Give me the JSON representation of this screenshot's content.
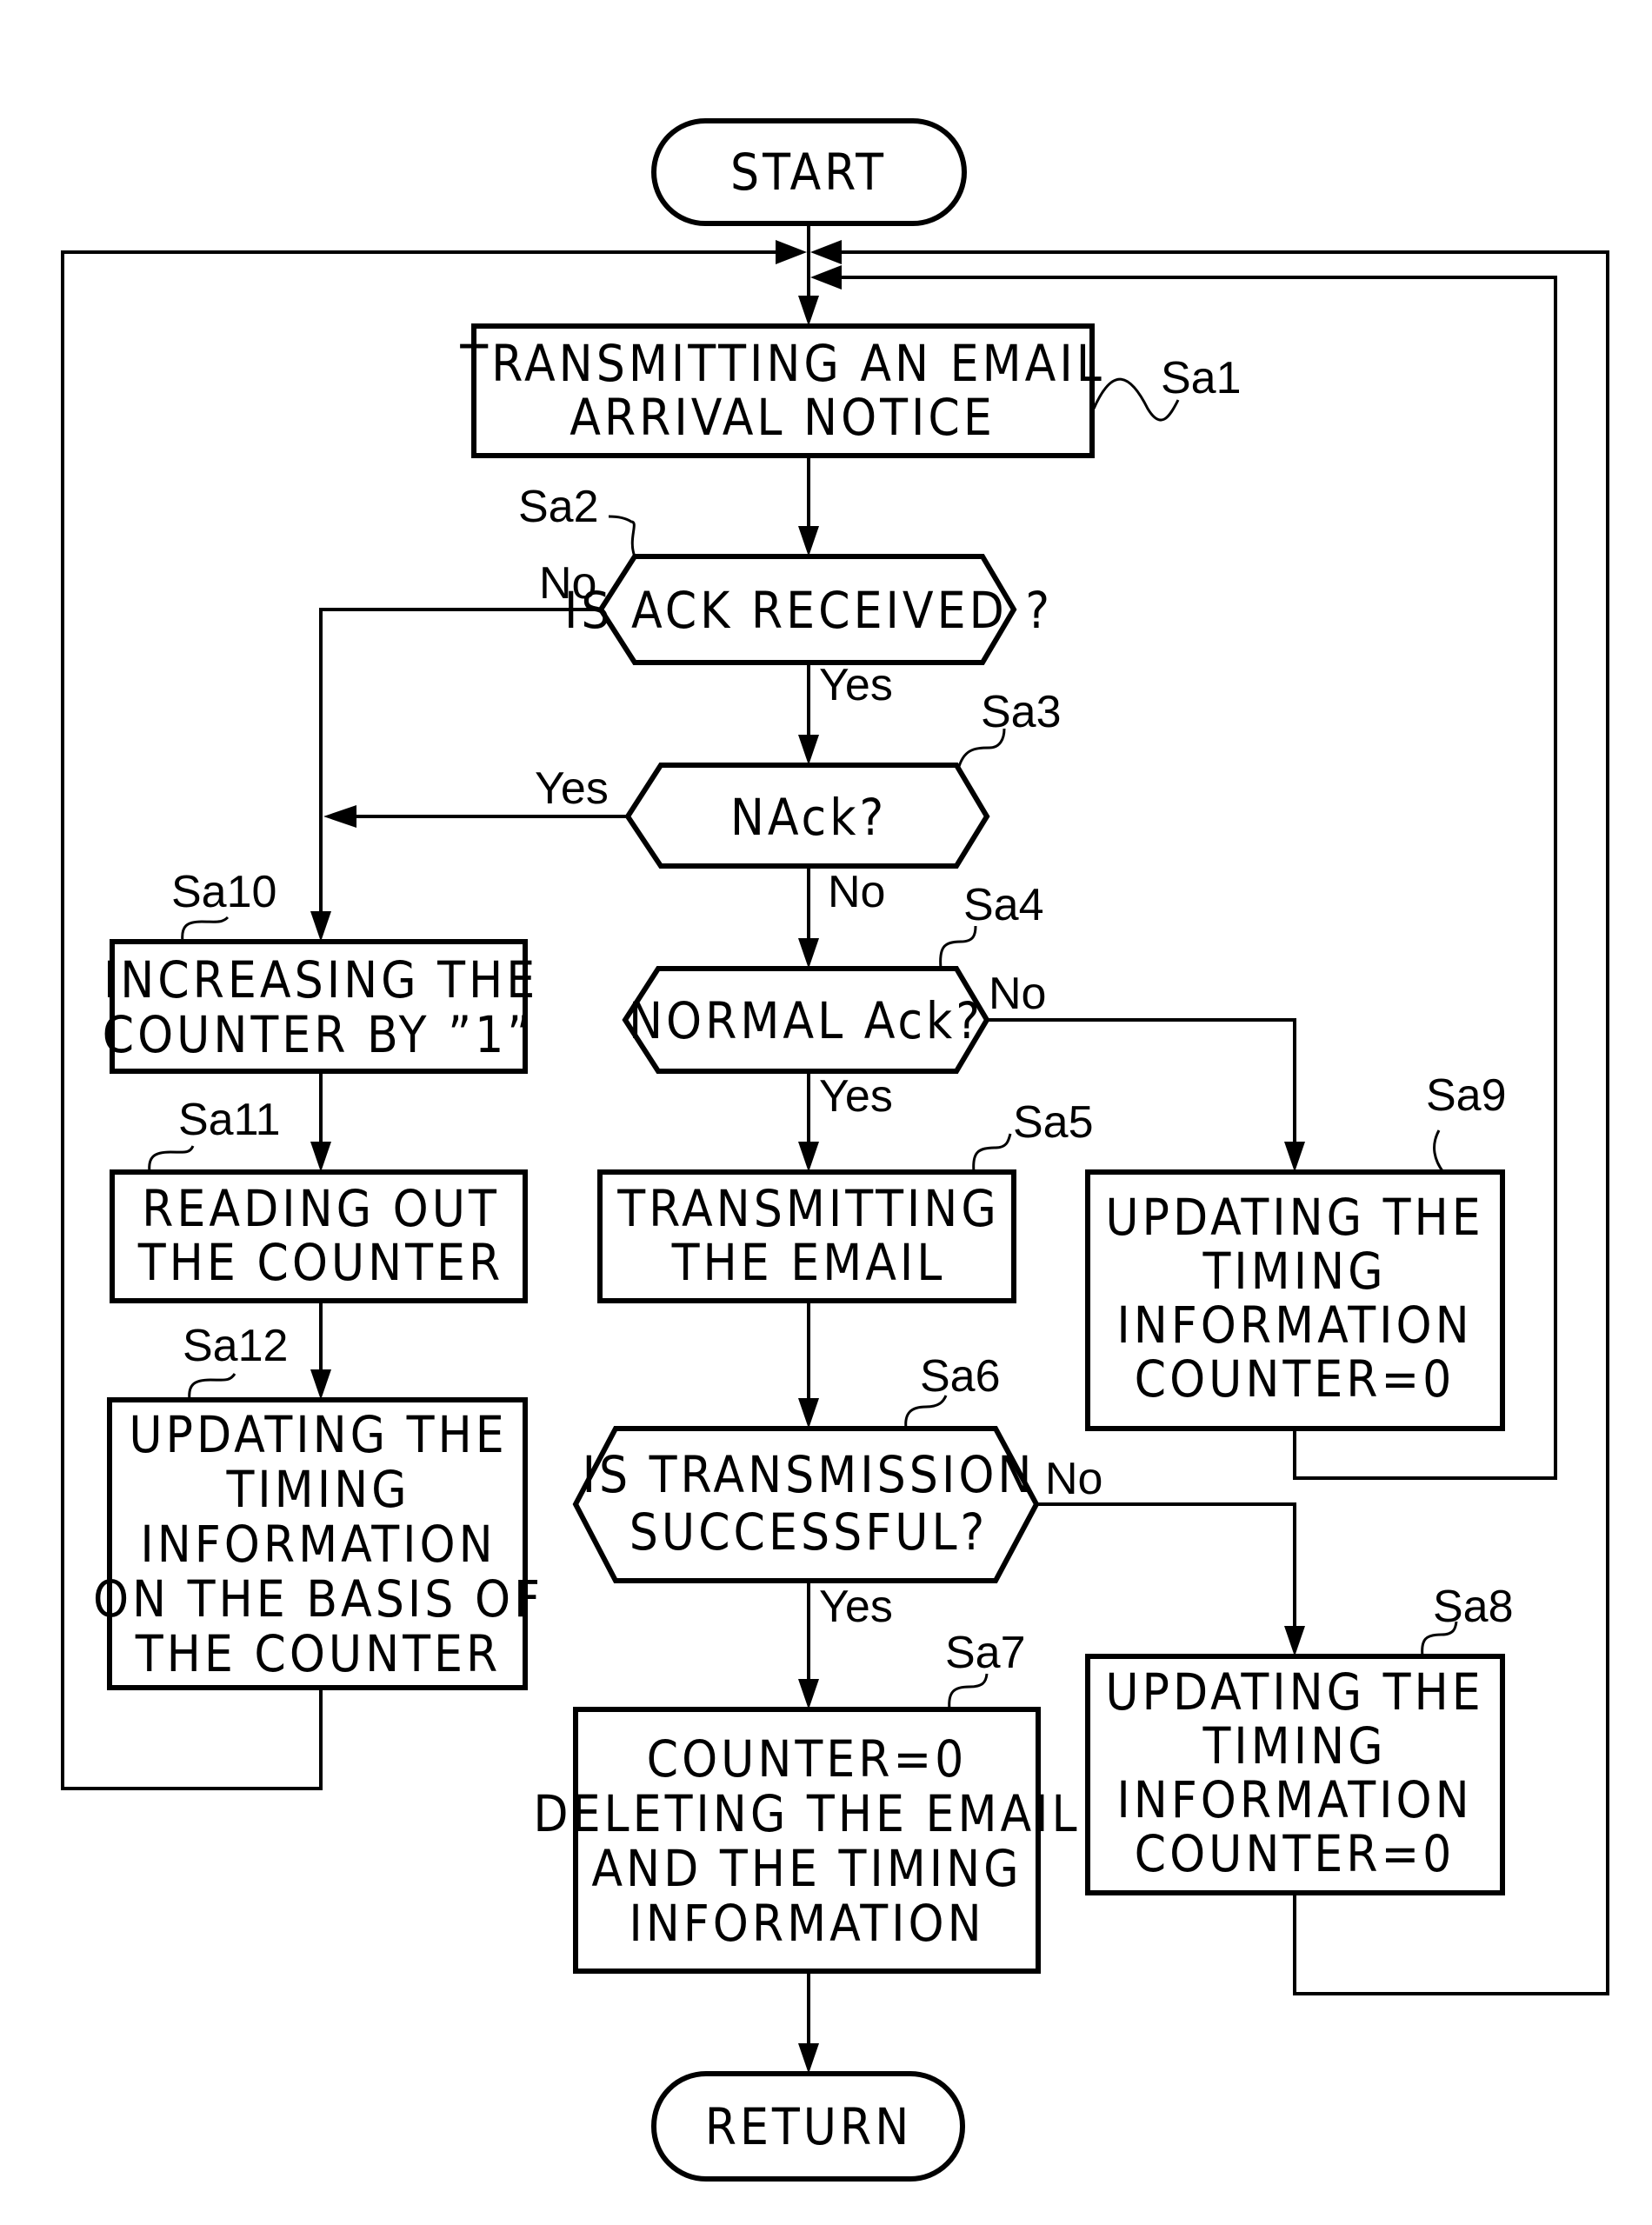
{
  "diagram": {
    "type": "flowchart",
    "start": {
      "label": "START"
    },
    "end": {
      "label": "RETURN"
    },
    "steps": [
      {
        "id": "Sa1",
        "kind": "process",
        "lines": [
          "TRANSMITTING AN EMAIL",
          "ARRIVAL NOTICE"
        ]
      },
      {
        "id": "Sa2",
        "kind": "decision",
        "lines": [
          "IS ACK RECEIVED ?"
        ]
      },
      {
        "id": "Sa3",
        "kind": "decision",
        "lines": [
          "NAck?"
        ]
      },
      {
        "id": "Sa4",
        "kind": "decision",
        "lines": [
          "NORMAL Ack?"
        ]
      },
      {
        "id": "Sa5",
        "kind": "process",
        "lines": [
          "TRANSMITTING",
          "THE EMAIL"
        ]
      },
      {
        "id": "Sa6",
        "kind": "decision",
        "lines": [
          "IS TRANSMISSION",
          "SUCCESSFUL?"
        ]
      },
      {
        "id": "Sa7",
        "kind": "process",
        "lines": [
          "COUNTER=0",
          "DELETING THE EMAIL",
          "AND THE TIMING",
          "INFORMATION"
        ]
      },
      {
        "id": "Sa8",
        "kind": "process",
        "lines": [
          "UPDATING THE",
          "TIMING",
          "INFORMATION",
          "COUNTER=0"
        ]
      },
      {
        "id": "Sa9",
        "kind": "process",
        "lines": [
          "UPDATING THE",
          "TIMING",
          "INFORMATION",
          "COUNTER=0"
        ]
      },
      {
        "id": "Sa10",
        "kind": "process",
        "lines": [
          "INCREASING THE",
          "COUNTER BY ”1”"
        ]
      },
      {
        "id": "Sa11",
        "kind": "process",
        "lines": [
          "READING OUT",
          "THE COUNTER"
        ]
      },
      {
        "id": "Sa12",
        "kind": "process",
        "lines": [
          "UPDATING THE",
          "TIMING",
          "INFORMATION",
          "ON THE BASIS OF",
          "THE COUNTER"
        ]
      }
    ],
    "edges": [
      {
        "from": "START",
        "to": "Sa1",
        "label": ""
      },
      {
        "from": "Sa1",
        "to": "Sa2",
        "label": ""
      },
      {
        "from": "Sa2",
        "to": "Sa3",
        "label": "Yes"
      },
      {
        "from": "Sa2",
        "to": "Sa10",
        "label": "No"
      },
      {
        "from": "Sa3",
        "to": "Sa10",
        "label": "Yes"
      },
      {
        "from": "Sa3",
        "to": "Sa4",
        "label": "No"
      },
      {
        "from": "Sa4",
        "to": "Sa5",
        "label": "Yes"
      },
      {
        "from": "Sa4",
        "to": "Sa9",
        "label": "No"
      },
      {
        "from": "Sa5",
        "to": "Sa6",
        "label": ""
      },
      {
        "from": "Sa6",
        "to": "Sa7",
        "label": "Yes"
      },
      {
        "from": "Sa6",
        "to": "Sa8",
        "label": "No"
      },
      {
        "from": "Sa7",
        "to": "RETURN",
        "label": ""
      },
      {
        "from": "Sa8",
        "to": "Sa1",
        "label": ""
      },
      {
        "from": "Sa9",
        "to": "Sa1",
        "label": ""
      },
      {
        "from": "Sa10",
        "to": "Sa11",
        "label": ""
      },
      {
        "from": "Sa11",
        "to": "Sa12",
        "label": ""
      },
      {
        "from": "Sa12",
        "to": "Sa1",
        "label": ""
      }
    ],
    "branch_labels": {
      "sa2_no": "No",
      "sa2_yes": "Yes",
      "sa3_yes": "Yes",
      "sa3_no": "No",
      "sa4_no": "No",
      "sa4_yes": "Yes",
      "sa6_no": "No",
      "sa6_yes": "Yes"
    }
  }
}
